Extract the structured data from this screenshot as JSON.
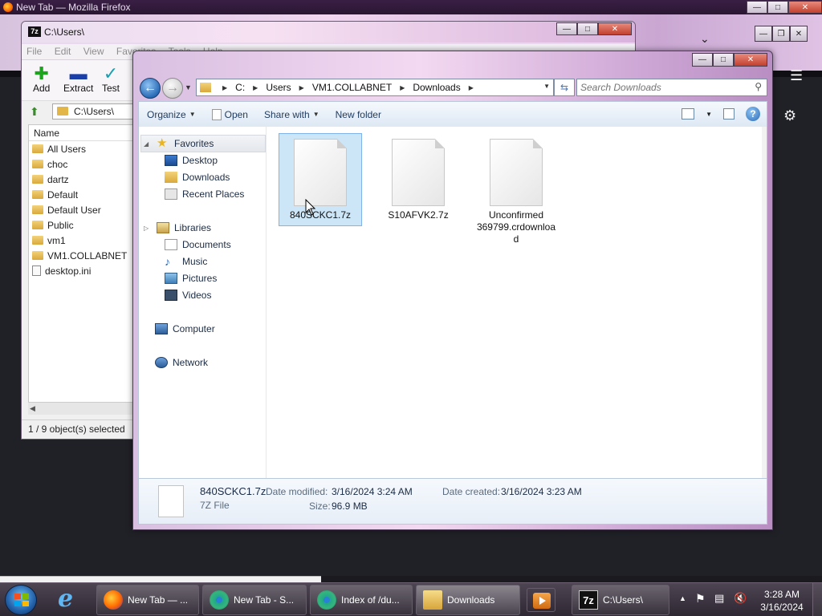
{
  "firefox": {
    "title": "New Tab — Mozilla Firefox"
  },
  "sevenzip": {
    "title": "C:\\Users\\",
    "app_icon": "7z",
    "menu": [
      "File",
      "Edit",
      "View",
      "Favorites",
      "Tools",
      "Help"
    ],
    "toolbar": {
      "add": "Add",
      "extract": "Extract",
      "test": "Test"
    },
    "path": "C:\\Users\\",
    "column_name": "Name",
    "items": [
      {
        "name": "All Users",
        "type": "folder"
      },
      {
        "name": "choc",
        "type": "folder"
      },
      {
        "name": "dartz",
        "type": "folder"
      },
      {
        "name": "Default",
        "type": "folder"
      },
      {
        "name": "Default User",
        "type": "folder"
      },
      {
        "name": "Public",
        "type": "folder"
      },
      {
        "name": "vm1",
        "type": "folder"
      },
      {
        "name": "VM1.COLLABNET",
        "type": "folder"
      },
      {
        "name": "desktop.ini",
        "type": "file"
      }
    ],
    "status": "1 / 9 object(s) selected"
  },
  "explorer": {
    "breadcrumb": [
      "C:",
      "Users",
      "VM1.COLLABNET",
      "Downloads"
    ],
    "search_placeholder": "Search Downloads",
    "commands": {
      "organize": "Organize",
      "open": "Open",
      "share_with": "Share with",
      "new_folder": "New folder"
    },
    "nav": {
      "favorites": "Favorites",
      "desktop": "Desktop",
      "downloads": "Downloads",
      "recent_places": "Recent Places",
      "libraries": "Libraries",
      "documents": "Documents",
      "music": "Music",
      "pictures": "Pictures",
      "videos": "Videos",
      "computer": "Computer",
      "network": "Network"
    },
    "files": [
      {
        "name": "840SCKC1.7z",
        "selected": true
      },
      {
        "name": "S10AFVK2.7z",
        "selected": false
      },
      {
        "name": "Unconfirmed 369799.crdownload",
        "selected": false
      }
    ],
    "details": {
      "name": "840SCKC1.7z",
      "type": "7Z File",
      "date_modified_label": "Date modified:",
      "date_modified": "3/16/2024 3:24 AM",
      "date_created_label": "Date created:",
      "date_created": "3/16/2024 3:23 AM",
      "size_label": "Size:",
      "size": "96.9 MB"
    }
  },
  "taskbar": {
    "buttons": [
      {
        "label": "New Tab — ...",
        "icon": "firefox-icon"
      },
      {
        "label": "New Tab - S...",
        "icon": "chrome-icon"
      },
      {
        "label": "Index of /du...",
        "icon": "chrome-icon"
      },
      {
        "label": "Downloads",
        "icon": "folder-icon"
      },
      {
        "label": "C:\\Users\\",
        "icon": "7zip-icon"
      }
    ],
    "clock_time": "3:28 AM",
    "clock_date": "3/16/2024"
  }
}
